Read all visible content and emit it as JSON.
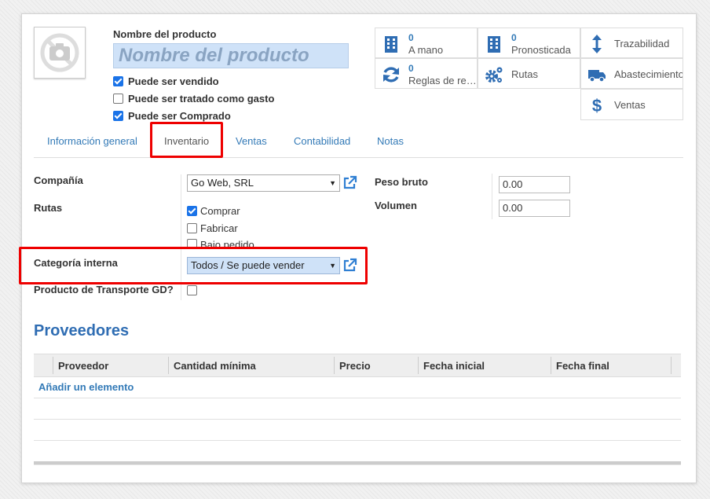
{
  "product": {
    "name_label": "Nombre del producto",
    "name_placeholder": "Nombre del producto",
    "checks": [
      {
        "label": "Puede ser vendido",
        "checked": true
      },
      {
        "label": "Puede ser tratado como gasto",
        "checked": false
      },
      {
        "label": "Puede ser Comprado",
        "checked": true
      }
    ]
  },
  "smart_buttons": {
    "on_hand": {
      "value": "0",
      "label": "A mano"
    },
    "forecast": {
      "value": "0",
      "label": "Pronosticada"
    },
    "traceability": {
      "label": "Trazabilidad"
    },
    "reorder": {
      "value": "0",
      "label": "Reglas de re…"
    },
    "routes": {
      "label": "Rutas"
    },
    "supply": {
      "label": "Abastecimientos"
    },
    "sales": {
      "label": "Ventas"
    }
  },
  "tabs": [
    "Información general",
    "Inventario",
    "Ventas",
    "Contabilidad",
    "Notas"
  ],
  "active_tab": "Inventario",
  "form": {
    "company_label": "Compañía",
    "company_value": "Go Web, SRL",
    "routes_label": "Rutas",
    "routes": [
      {
        "label": "Comprar",
        "checked": true
      },
      {
        "label": "Fabricar",
        "checked": false
      },
      {
        "label": "Bajo pedido",
        "checked": false
      }
    ],
    "category_label": "Categoría interna",
    "category_value": "Todos / Se puede vender",
    "transport_label": "Producto de Transporte GD?",
    "weight_label": "Peso bruto",
    "weight_value": "0.00",
    "volume_label": "Volumen",
    "volume_value": "0.00"
  },
  "vendors": {
    "title": "Proveedores",
    "columns": [
      "Proveedor",
      "Cantidad mínima",
      "Precio",
      "Fecha inicial",
      "Fecha final"
    ],
    "add_label": "Añadir un elemento"
  },
  "colors": {
    "accent": "#337ab7",
    "highlight": "#e00000",
    "input_bg": "#cfe2f8"
  }
}
